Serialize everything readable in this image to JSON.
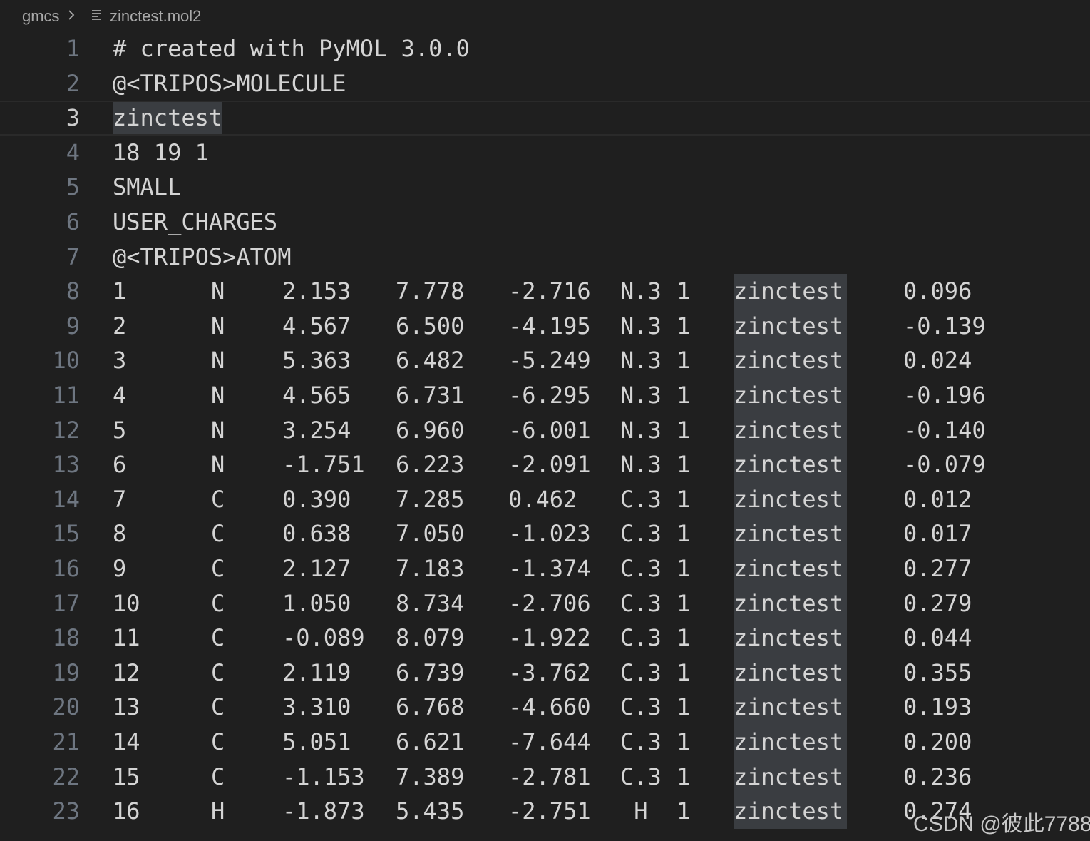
{
  "breadcrumb": {
    "folder": "gmcs",
    "chevron_icon": "chevron-right-icon",
    "file_icon": "lines-file-icon",
    "file": "zinctest.mol2"
  },
  "editor": {
    "header_lines": [
      {
        "num": "1",
        "text": "# created with PyMOL 3.0.0"
      },
      {
        "num": "2",
        "text": "@<TRIPOS>MOLECULE"
      },
      {
        "num": "3",
        "text": "zinctest"
      },
      {
        "num": "4",
        "text": "18 19 1"
      },
      {
        "num": "5",
        "text": "SMALL"
      },
      {
        "num": "6",
        "text": "USER_CHARGES"
      },
      {
        "num": "7",
        "text": "@<TRIPOS>ATOM"
      }
    ],
    "active_line": "3",
    "atom_rows": [
      {
        "num": "8",
        "id": "1",
        "name": "N",
        "x": "2.153",
        "y": "7.778",
        "z": "-2.716",
        "type": "N.3",
        "sub": "1",
        "res": "zinctest",
        "charge": "0.096"
      },
      {
        "num": "9",
        "id": "2",
        "name": "N",
        "x": "4.567",
        "y": "6.500",
        "z": "-4.195",
        "type": "N.3",
        "sub": "1",
        "res": "zinctest",
        "charge": "-0.139"
      },
      {
        "num": "10",
        "id": "3",
        "name": "N",
        "x": "5.363",
        "y": "6.482",
        "z": "-5.249",
        "type": "N.3",
        "sub": "1",
        "res": "zinctest",
        "charge": "0.024"
      },
      {
        "num": "11",
        "id": "4",
        "name": "N",
        "x": "4.565",
        "y": "6.731",
        "z": "-6.295",
        "type": "N.3",
        "sub": "1",
        "res": "zinctest",
        "charge": "-0.196"
      },
      {
        "num": "12",
        "id": "5",
        "name": "N",
        "x": "3.254",
        "y": "6.960",
        "z": "-6.001",
        "type": "N.3",
        "sub": "1",
        "res": "zinctest",
        "charge": "-0.140"
      },
      {
        "num": "13",
        "id": "6",
        "name": "N",
        "x": "-1.751",
        "y": "6.223",
        "z": "-2.091",
        "type": "N.3",
        "sub": "1",
        "res": "zinctest",
        "charge": "-0.079"
      },
      {
        "num": "14",
        "id": "7",
        "name": "C",
        "x": "0.390",
        "y": "7.285",
        "z": "0.462",
        "type": "C.3",
        "sub": "1",
        "res": "zinctest",
        "charge": "0.012"
      },
      {
        "num": "15",
        "id": "8",
        "name": "C",
        "x": "0.638",
        "y": "7.050",
        "z": "-1.023",
        "type": "C.3",
        "sub": "1",
        "res": "zinctest",
        "charge": "0.017"
      },
      {
        "num": "16",
        "id": "9",
        "name": "C",
        "x": "2.127",
        "y": "7.183",
        "z": "-1.374",
        "type": "C.3",
        "sub": "1",
        "res": "zinctest",
        "charge": "0.277"
      },
      {
        "num": "17",
        "id": "10",
        "name": "C",
        "x": "1.050",
        "y": "8.734",
        "z": "-2.706",
        "type": "C.3",
        "sub": "1",
        "res": "zinctest",
        "charge": "0.279"
      },
      {
        "num": "18",
        "id": "11",
        "name": "C",
        "x": "-0.089",
        "y": "8.079",
        "z": "-1.922",
        "type": "C.3",
        "sub": "1",
        "res": "zinctest",
        "charge": "0.044"
      },
      {
        "num": "19",
        "id": "12",
        "name": "C",
        "x": "2.119",
        "y": "6.739",
        "z": "-3.762",
        "type": "C.3",
        "sub": "1",
        "res": "zinctest",
        "charge": "0.355"
      },
      {
        "num": "20",
        "id": "13",
        "name": "C",
        "x": "3.310",
        "y": "6.768",
        "z": "-4.660",
        "type": "C.3",
        "sub": "1",
        "res": "zinctest",
        "charge": "0.193"
      },
      {
        "num": "21",
        "id": "14",
        "name": "C",
        "x": "5.051",
        "y": "6.621",
        "z": "-7.644",
        "type": "C.3",
        "sub": "1",
        "res": "zinctest",
        "charge": "0.200"
      },
      {
        "num": "22",
        "id": "15",
        "name": "C",
        "x": "-1.153",
        "y": "7.389",
        "z": "-2.781",
        "type": "C.3",
        "sub": "1",
        "res": "zinctest",
        "charge": "0.236"
      },
      {
        "num": "23",
        "id": "16",
        "name": "H",
        "x": "-1.873",
        "y": "5.435",
        "z": "-2.751",
        "type": " H",
        "sub": "1",
        "res": "zinctest",
        "charge": "0.274"
      }
    ]
  },
  "watermark": "CSDN @彼此7788",
  "colors": {
    "background": "#1f1f1f",
    "text": "#d4d4d4",
    "gutter": "#6e7681",
    "highlight": "#3a3d41"
  }
}
